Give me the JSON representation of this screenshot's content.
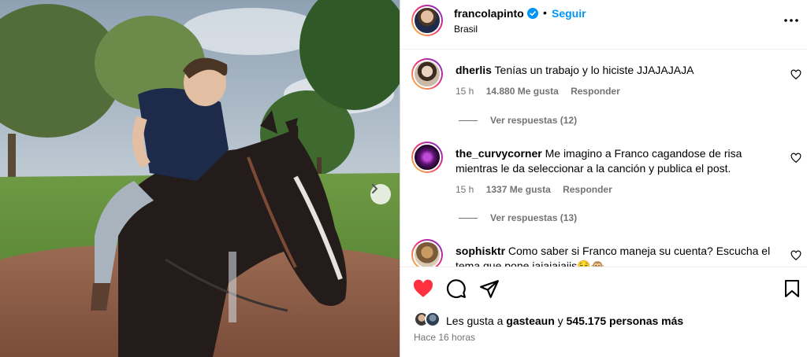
{
  "post": {
    "username": "francolapinto",
    "follow_label": "Seguir",
    "separator": "•",
    "location": "Brasil",
    "time_ago": "Hace 16 horas"
  },
  "likes": {
    "prefix": "Les gusta a",
    "liked_by": "gasteaun",
    "connector": "y",
    "others": "545.175 personas más"
  },
  "comments": [
    {
      "username": "dherlis",
      "text": "Tenías un trabajo y lo hiciste JJAJAJAJA",
      "time": "15 h",
      "likes": "14.880 Me gusta",
      "reply_label": "Responder",
      "view_replies": "Ver respuestas (12)"
    },
    {
      "username": "the_curvycorner",
      "text": "Me imagino a Franco cagandose de risa mientras le da seleccionar a la canción y publica el post.",
      "time": "15 h",
      "likes": "1337 Me gusta",
      "reply_label": "Responder",
      "view_replies": "Ver respuestas (13)"
    },
    {
      "username": "sophisktr",
      "text": "Como saber si Franco maneja su cuenta? Escucha el tema que pone jajajajajjs😌🐵"
    }
  ],
  "icons": {
    "verified": "verified-badge-icon",
    "more": "more-options-icon",
    "next": "chevron-right-icon",
    "like": "heart-icon",
    "comment": "comment-icon",
    "share": "send-icon",
    "save": "bookmark-icon"
  },
  "colors": {
    "accent": "#0095f6",
    "liked": "#ff3040",
    "muted": "#737373"
  }
}
